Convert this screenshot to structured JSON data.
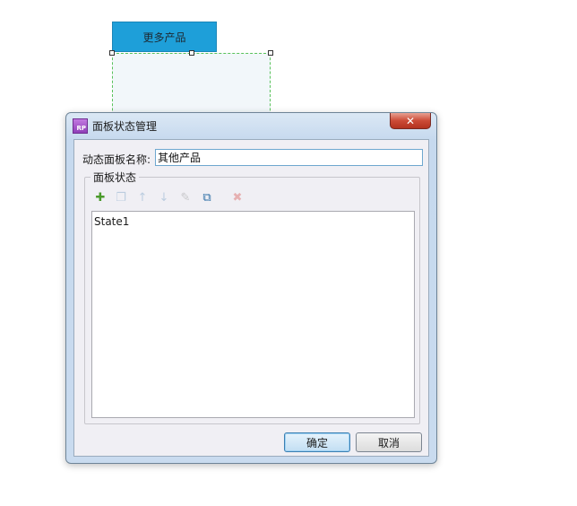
{
  "canvas": {
    "button_label": "更多产品"
  },
  "dialog": {
    "title": "面板状态管理",
    "app_icon_text": "RP",
    "close_glyph": "✕",
    "name_label": "动态面板名称:",
    "name_value": "其他产品",
    "group_label": "面板状态",
    "toolbar": [
      {
        "icon": "add-state-icon",
        "glyph": "✚",
        "enabled": true
      },
      {
        "icon": "duplicate-state-icon",
        "glyph": "❐",
        "enabled": false
      },
      {
        "icon": "move-up-icon",
        "glyph": "↑",
        "enabled": false
      },
      {
        "icon": "move-down-icon",
        "glyph": "↓",
        "enabled": false
      },
      {
        "icon": "edit-state-icon",
        "glyph": "✎",
        "enabled": false
      },
      {
        "icon": "edit-all-states-icon",
        "glyph": "⧉",
        "enabled": true
      },
      {
        "icon": "delete-state-icon",
        "glyph": "✖",
        "enabled": false
      }
    ],
    "states": [
      "State1"
    ],
    "ok_label": "确定",
    "cancel_label": "取消"
  },
  "colors": {
    "canvas_button": "#1e9fd9",
    "add_icon": "#4a9a2b",
    "edit_all_icon": "#2e6fa6",
    "delete_icon": "#d9534f"
  }
}
